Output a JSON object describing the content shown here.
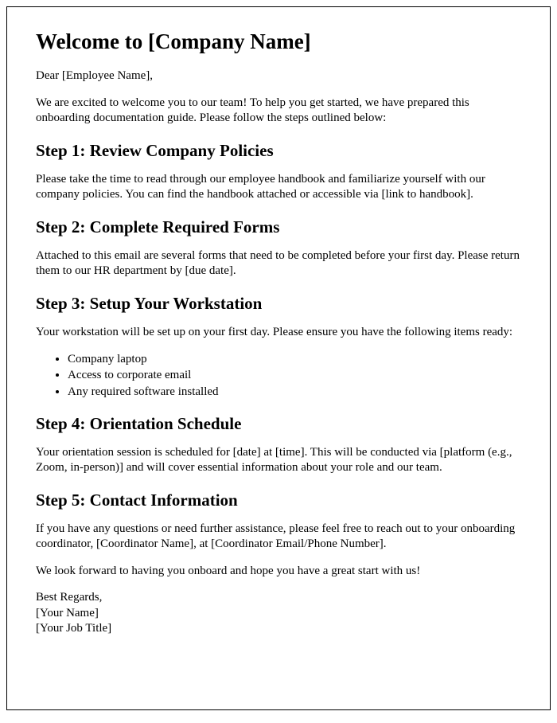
{
  "title": "Welcome to [Company Name]",
  "greeting": "Dear [Employee Name],",
  "intro": "We are excited to welcome you to our team! To help you get started, we have prepared this onboarding documentation guide. Please follow the steps outlined below:",
  "step1": {
    "heading": "Step 1: Review Company Policies",
    "body": "Please take the time to read through our employee handbook and familiarize yourself with our company policies. You can find the handbook attached or accessible via [link to handbook]."
  },
  "step2": {
    "heading": "Step 2: Complete Required Forms",
    "body": "Attached to this email are several forms that need to be completed before your first day. Please return them to our HR department by [due date]."
  },
  "step3": {
    "heading": "Step 3: Setup Your Workstation",
    "body": "Your workstation will be set up on your first day. Please ensure you have the following items ready:",
    "items": [
      "Company laptop",
      "Access to corporate email",
      "Any required software installed"
    ]
  },
  "step4": {
    "heading": "Step 4: Orientation Schedule",
    "body": "Your orientation session is scheduled for [date] at [time]. This will be conducted via [platform (e.g., Zoom, in-person)] and will cover essential information about your role and our team."
  },
  "step5": {
    "heading": "Step 5: Contact Information",
    "body": "If you have any questions or need further assistance, please feel free to reach out to your onboarding coordinator, [Coordinator Name], at [Coordinator Email/Phone Number]."
  },
  "closing": "We look forward to having you onboard and hope you have a great start with us!",
  "signoff": {
    "regards": "Best Regards,",
    "name": "[Your Name]",
    "title": "[Your Job Title]"
  }
}
